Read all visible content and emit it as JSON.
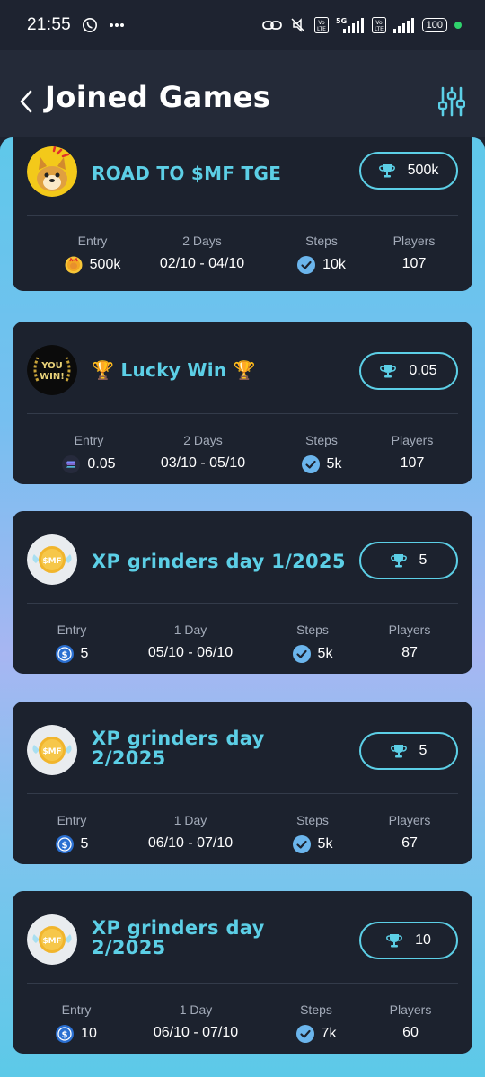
{
  "status_bar": {
    "time": "21:55",
    "battery": "100",
    "icons": [
      "whatsapp-icon",
      "more-dots-icon",
      "link-icon",
      "mute-icon",
      "volte-icon",
      "signal-5g-icon",
      "signal-icon",
      "battery-icon"
    ]
  },
  "header": {
    "title": "Joined Games",
    "back_icon": "chevron-left-icon",
    "filter_icon": "sliders-icon"
  },
  "labels": {
    "entry": "Entry",
    "steps": "Steps",
    "players": "Players"
  },
  "games": [
    {
      "title": "ROAD TO $MF TGE",
      "avatar": "doge-avatar",
      "prize": "500k",
      "duration": "2 Days",
      "entry": "500k",
      "entry_icon": "coin-icon",
      "dates": "02/10 - 04/10",
      "steps": "10k",
      "players": "107"
    },
    {
      "title": "🏆 Lucky Win 🏆",
      "avatar": "you-win-avatar",
      "avatar_text_1": "YOU",
      "avatar_text_2": "WIN!",
      "prize": "0.05",
      "duration": "2 Days",
      "entry": "0.05",
      "entry_icon": "solana-icon",
      "dates": "03/10 - 05/10",
      "steps": "5k",
      "players": "107"
    },
    {
      "title": "XP grinders day 1/2025",
      "avatar": "smf-coin-avatar",
      "avatar_text": "$MF",
      "prize": "5",
      "duration": "1 Day",
      "entry": "5",
      "entry_icon": "dollar-coin-icon",
      "dates": "05/10 - 06/10",
      "steps": "5k",
      "players": "87"
    },
    {
      "title": "XP grinders day 2/2025",
      "avatar": "smf-coin-avatar",
      "avatar_text": "$MF",
      "prize": "5",
      "duration": "1 Day",
      "entry": "5",
      "entry_icon": "dollar-coin-icon",
      "dates": "06/10 - 07/10",
      "steps": "5k",
      "players": "67"
    },
    {
      "title": "XP grinders day 2/2025",
      "avatar": "smf-coin-avatar",
      "avatar_text": "$MF",
      "prize": "10",
      "duration": "1 Day",
      "entry": "10",
      "entry_icon": "dollar-coin-icon",
      "dates": "06/10 - 07/10",
      "steps": "7k",
      "players": "60"
    }
  ],
  "colors": {
    "accent": "#5ccfe6",
    "card_bg": "#1c222e",
    "page_bg": "#1e2330"
  }
}
